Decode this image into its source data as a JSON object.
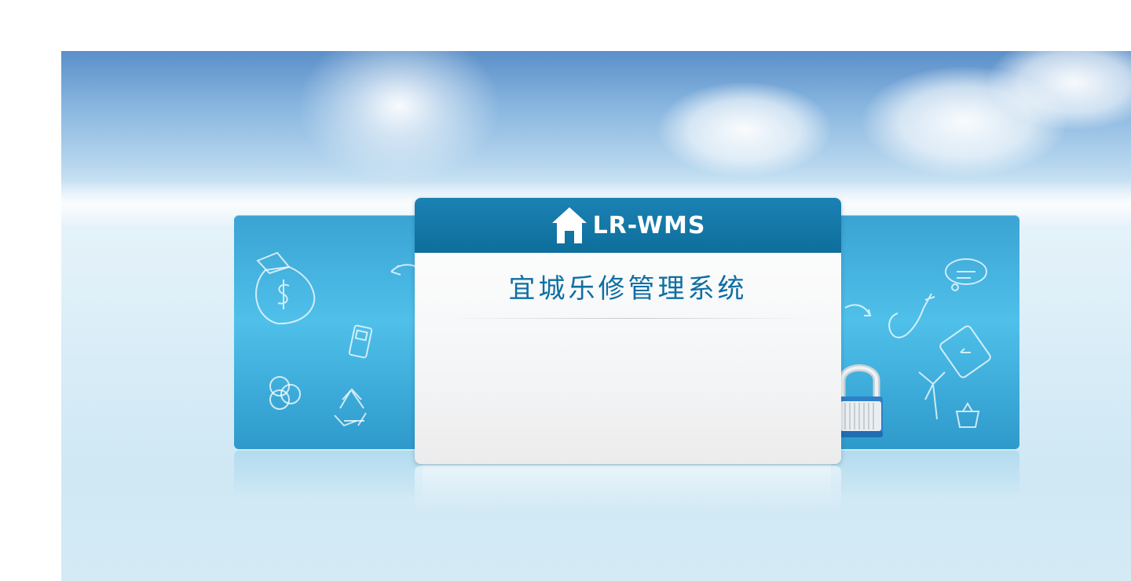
{
  "brand": {
    "logo_icon": "house-icon",
    "name": "LR-WMS"
  },
  "login": {
    "system_title": "宜城乐修管理系统"
  },
  "decor_icons": {
    "left": [
      "money-bag-icon",
      "mobile-phone-icon",
      "flower-icon",
      "recycle-icon",
      "arrow-icon"
    ],
    "right": [
      "cloud-icon",
      "phone-receiver-icon",
      "tablet-icon",
      "wind-turbine-icon",
      "basket-icon",
      "arrow-icon",
      "padlock-icon"
    ]
  },
  "colors": {
    "header_blue": "#0d6e9b",
    "title_blue": "#0d6fa3",
    "panel_blue": "#3aa3d3"
  }
}
